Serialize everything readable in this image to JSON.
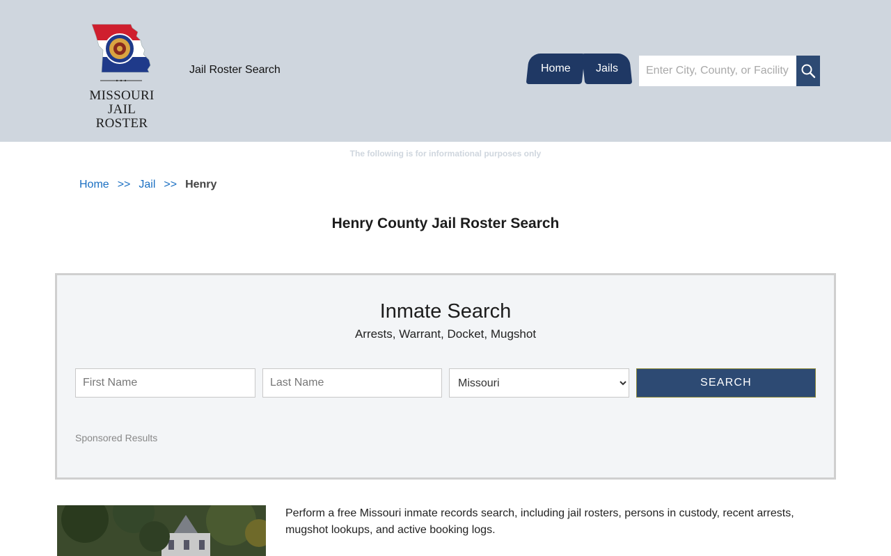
{
  "header": {
    "logo_line1": "MISSOURI",
    "logo_line2": "JAIL ROSTER",
    "site_tagline": "Jail Roster Search",
    "nav": [
      {
        "label": "Home"
      },
      {
        "label": "Jails"
      }
    ],
    "search_placeholder": "Enter City, County, or Facility"
  },
  "disclaimer": "The following is for informational purposes only",
  "breadcrumb": {
    "items": [
      "Home",
      "Jail"
    ],
    "separator": ">>",
    "current": "Henry"
  },
  "page_title": "Henry County Jail Roster Search",
  "inmate_search": {
    "title": "Inmate Search",
    "subtitle": "Arrests, Warrant, Docket, Mugshot",
    "first_name_placeholder": "First Name",
    "last_name_placeholder": "Last Name",
    "state_selected": "Missouri",
    "search_label": "SEARCH",
    "sponsored": "Sponsored Results"
  },
  "intro_text": "Perform a free Missouri inmate records search, including jail rosters, persons in custody, recent arrests, mugshot lookups, and active booking logs.",
  "colors": {
    "header_bg": "#cfd6de",
    "nav_bg": "#1f3864",
    "button_bg": "#2d4a73",
    "link": "#1a6fc2"
  }
}
